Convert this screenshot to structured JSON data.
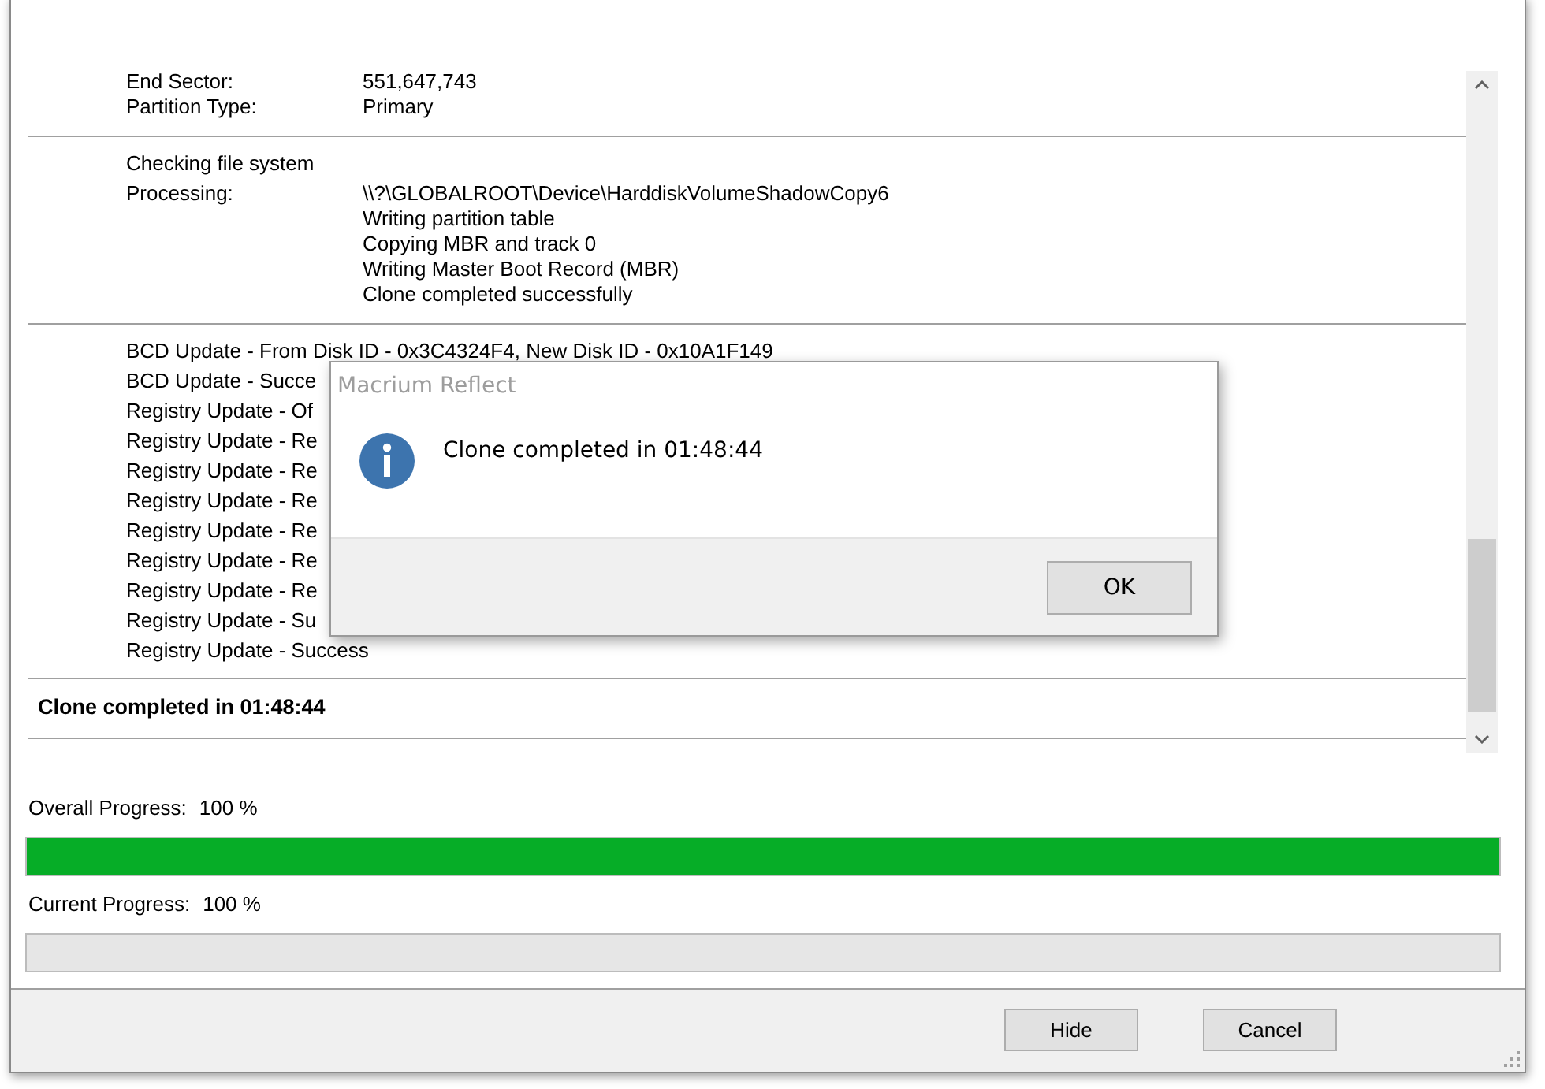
{
  "log": {
    "sections": [
      {
        "kind": "pairs",
        "entries": [
          {
            "label": "End Sector:",
            "value": "551,647,743"
          },
          {
            "label": "Partition Type:",
            "value": "Primary"
          }
        ]
      },
      {
        "kind": "pairs",
        "entries": [
          {
            "label": "Checking file system"
          },
          {
            "label": "Processing:",
            "value": "\\\\?\\GLOBALROOT\\Device\\HarddiskVolumeShadowCopy6"
          },
          {
            "value": "Writing partition table"
          },
          {
            "value": "Copying MBR and track 0"
          },
          {
            "value": "Writing Master Boot Record (MBR)"
          },
          {
            "value": "Clone completed successfully"
          }
        ]
      },
      {
        "kind": "lines",
        "lines": [
          "BCD Update - From Disk ID - 0x3C4324F4,  New Disk ID - 0x10A1F149",
          "BCD Update - Succe",
          "Registry Update - Of",
          "Registry Update - Re",
          "Registry Update - Re",
          "Registry Update - Re",
          "Registry Update - Re",
          "Registry Update - Re",
          "Registry Update - Re",
          "Registry Update - Su",
          "Registry Update - Success"
        ]
      },
      {
        "kind": "summary",
        "text": "Clone completed in 01:48:44"
      }
    ]
  },
  "progress": [
    {
      "label": "Overall Progress:",
      "reading": "100 %",
      "level": 1
    },
    {
      "label": "Current Progress:",
      "reading": "100 %",
      "level": 0
    }
  ],
  "buttons": [
    "Hide",
    "Cancel"
  ],
  "dialog": {
    "title": "Macrium Reflect",
    "message": "Clone completed in 01:48:44",
    "buttons": [
      "OK"
    ]
  }
}
